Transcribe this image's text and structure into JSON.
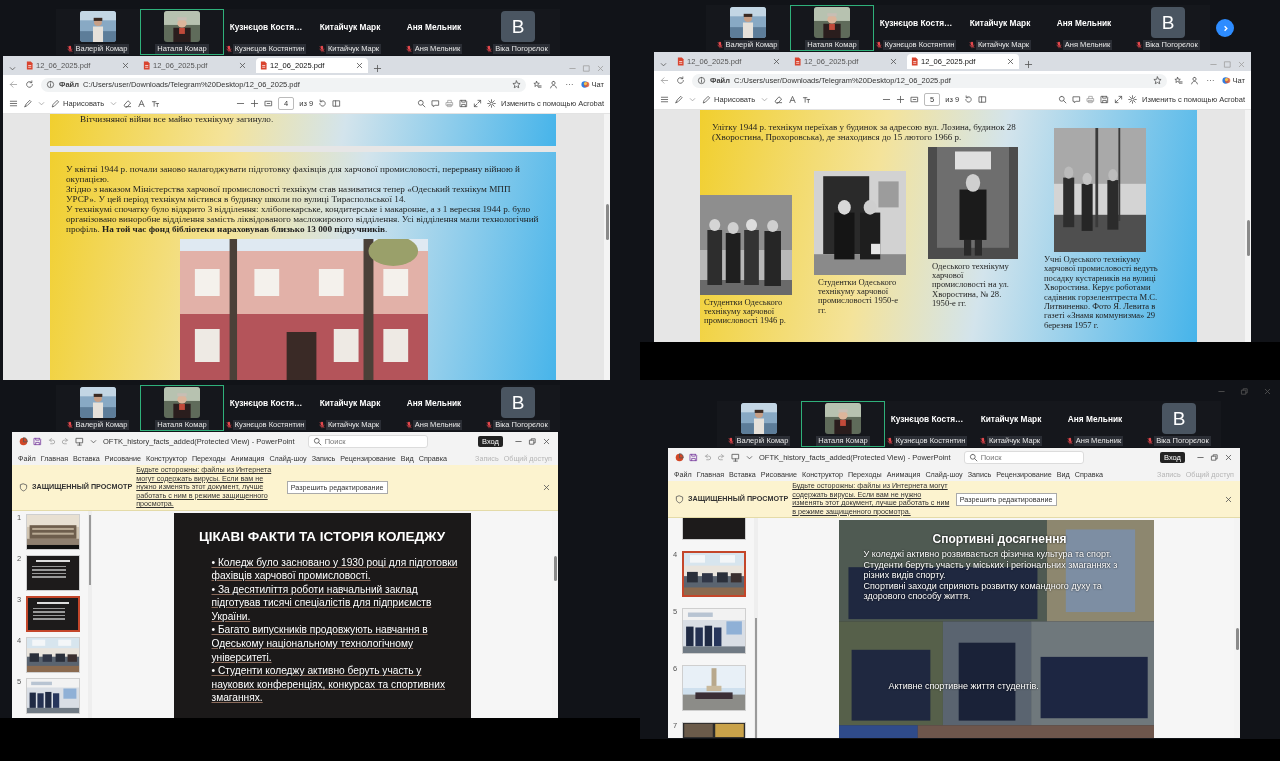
{
  "panes": [
    {
      "kind": "pdf",
      "participants": [
        {
          "kind": "video",
          "label": "Валерій Комар",
          "muted": true,
          "selected": false
        },
        {
          "kind": "video",
          "label": "Наталя Комар",
          "muted": false,
          "selected": true
        },
        {
          "kind": "name",
          "name": "Кузнєцов Костя…",
          "label": "Кузнєцов Костянтин",
          "muted": true,
          "selected": false
        },
        {
          "kind": "name",
          "name": "Китайчук Марк",
          "label": "Китайчук Марк",
          "muted": true,
          "selected": false
        },
        {
          "kind": "name",
          "name": "Аня Мельник",
          "label": "Аня Мельник",
          "muted": true,
          "selected": false
        },
        {
          "kind": "avatar",
          "initial": "B",
          "label": "Віка Погорєлок",
          "muted": true,
          "selected": false
        }
      ],
      "viewer": {
        "tabs": [
          {
            "label": "12_06_2025.pdf",
            "selected": false
          },
          {
            "label": "12_06_2025.pdf",
            "selected": false
          },
          {
            "label": "12_06_2025.pdf",
            "selected": true
          }
        ],
        "file_chip": "Файл",
        "address": "C:/Users/user/Downloads/Telegram%20Desktop/12_06_2025.pdf",
        "chat": "Чат",
        "draw": "Нарисовать",
        "page": "4",
        "page_total": "из 9",
        "edit_action": "Изменить с помощью Acrobat",
        "document": {
          "kind": "article",
          "lead": "Вітчизняної війни все майно технікуму загинуло.",
          "paragraphs": [
            "У квітні 1944 р. почали заново налагоджувати підготовку фахівців для харчової промисловості, перервану війною й окупацією.",
            "Згідно з наказом Міністерства харчової промисловості технікум став називатися тепер «Одеський технікум МПП УРСР». У цей період технікум містився в будинку школи по вулиці Тираспольської 14.",
            "У технікумі спочатку було відкрито 3 відділення: хлібопекарське, кондитерське і макаронне, а з 1 вересня 1944 р. було організовано виноробне відділення замість ліквідованого масложирового відділення. Усі відділення мали технологічний профіль. **На той час фонд бібліотеки нараховував близько 13 000 підручників**."
          ]
        }
      }
    },
    {
      "kind": "pdf",
      "next_button": true,
      "participants": [
        {
          "kind": "video",
          "label": "Валерій Комар",
          "muted": true,
          "selected": false
        },
        {
          "kind": "video",
          "label": "Наталя Комар",
          "muted": false,
          "selected": true
        },
        {
          "kind": "name",
          "name": "Кузнєцов Костя…",
          "label": "Кузнєцов Костянтин",
          "muted": true,
          "selected": false
        },
        {
          "kind": "name",
          "name": "Китайчук Марк",
          "label": "Китайчук Марк",
          "muted": true,
          "selected": false
        },
        {
          "kind": "name",
          "name": "Аня Мельник",
          "label": "Аня Мельник",
          "muted": true,
          "selected": false
        },
        {
          "kind": "avatar",
          "initial": "B",
          "label": "Віка Погорєлок",
          "muted": true,
          "selected": false
        }
      ],
      "viewer": {
        "tabs": [
          {
            "label": "12_06_2025.pdf",
            "selected": false
          },
          {
            "label": "12_06_2025.pdf",
            "selected": false
          },
          {
            "label": "12_06_2025.pdf",
            "selected": true
          }
        ],
        "file_chip": "Файл",
        "address": "C:/Users/user/Downloads/Telegram%20Desktop/12_06_2025.pdf",
        "chat": "Чат",
        "draw": "Нарисовать",
        "page": "5",
        "page_total": "из 9",
        "edit_action": "Изменить с помощью Acrobat",
        "document": {
          "kind": "gallery",
          "paragraphs": [
            "Улітку 1944 р. технікум переїхав у будинок за адресою вул. Лозина, будинок 28 (Хворостина, Прохоровська), де знаходився до 15 лютого 1966 р."
          ],
          "photos": [
            {
              "caption": "Студентки Одеського технікуму харчової промисловості 1946 р."
            },
            {
              "caption": "Студентки Одеського технікуму харчової промисловості 1950-е гг."
            },
            {
              "caption": "Одеського технікуму харчової промисловості на ул. Хворостина, № 28. 1950-е гг."
            },
            {
              "caption": "Учні Одеського технікуму харчової промисловості ведуть посадку кустарників на вулиці Хворостина. Керує роботами садівник горзеленттреста М.С. Литвиненко. Фото Я. Левита в газеті «Знамя коммунизма» 29 березня 1957 г."
            }
          ]
        }
      }
    },
    {
      "kind": "slides",
      "participants": [
        {
          "kind": "video",
          "label": "Валерій Комар",
          "muted": true,
          "selected": false
        },
        {
          "kind": "video",
          "label": "Наталя Комар",
          "muted": false,
          "selected": true
        },
        {
          "kind": "name",
          "name": "Кузнєцов Костя…",
          "label": "Кузнєцов Костянтин",
          "muted": true,
          "selected": false
        },
        {
          "kind": "name",
          "name": "Китайчук Марк",
          "label": "Китайчук Марк",
          "muted": true,
          "selected": false
        },
        {
          "kind": "name",
          "name": "Аня Мельник",
          "label": "Аня Мельник",
          "muted": true,
          "selected": false
        },
        {
          "kind": "avatar",
          "initial": "B",
          "label": "Віка Погорєлок",
          "muted": true,
          "selected": false
        }
      ],
      "app": {
        "title": "OFTK_history_facts_added(Protected View) - PowerPoint",
        "search": {
          "placeholder": "Поиск"
        },
        "signin": "Вход",
        "menu": [
          "Файл",
          "Главная",
          "Вставка",
          "Рисование",
          "Конструктор",
          "Переходы",
          "Анимация",
          "Слайд-шоу",
          "Запись",
          "Рецензирование",
          "Вид",
          "Справка"
        ],
        "actions": [
          {
            "label": "Запись",
            "disabled": true
          },
          {
            "label": "Общий доступ",
            "disabled": true
          }
        ],
        "notice": {
          "label": "ЗАЩИЩЕННЫЙ ПРОСМОТР",
          "message": "Будьте осторожны: файлы из Интернета могут содержать вирусы. Если вам не нужно изменять этот документ, лучше работать с ним в режиме защищенного просмотра.",
          "button": "Разрешить редактирование"
        },
        "thumbnails": [
          {
            "number": "1",
            "selected": false
          },
          {
            "number": "2",
            "kind": "text",
            "selected": false
          },
          {
            "number": "3",
            "kind": "text",
            "selected": true
          },
          {
            "number": "4",
            "selected": false
          },
          {
            "number": "5",
            "selected": false
          }
        ],
        "slide": {
          "kind": "bullets",
          "title": "ЦІКАВІ ФАКТИ ТА ІСТОРІЯ КОЛЕДЖУ",
          "bullets": [
            "• Коледж було засновано у 1930 році для підготовки фахівців харчової промисловості.",
            "• За десятиліття роботи навчальний заклад підготував тисячі спеціалістів для підприємств України.",
            "• Багато випускників продовжують навчання в Одеському національному технологічному університеті.",
            "• Студенти коледжу активно беруть участь у наукових конференціях, конкурсах та спортивних змаганнях."
          ]
        }
      }
    },
    {
      "kind": "slides",
      "window_controls": true,
      "participants": [
        {
          "kind": "video",
          "label": "Валерій Комар",
          "muted": true,
          "selected": false
        },
        {
          "kind": "video",
          "label": "Наталя Комар",
          "muted": false,
          "selected": true
        },
        {
          "kind": "name",
          "name": "Кузнєцов Костя…",
          "label": "Кузнєцов Костянтин",
          "muted": true,
          "selected": false
        },
        {
          "kind": "name",
          "name": "Китайчук Марк",
          "label": "Китайчук Марк",
          "muted": true,
          "selected": false
        },
        {
          "kind": "name",
          "name": "Аня Мельник",
          "label": "Аня Мельник",
          "muted": true,
          "selected": false
        },
        {
          "kind": "avatar",
          "initial": "B",
          "label": "Віка Погорєлок",
          "muted": true,
          "selected": false
        }
      ],
      "app": {
        "title": "OFTK_history_facts_added(Protected View) - PowerPoint",
        "search": {
          "placeholder": "Поиск"
        },
        "signin": "Вход",
        "menu": [
          "Файл",
          "Главная",
          "Вставка",
          "Рисование",
          "Конструктор",
          "Переходы",
          "Анимация",
          "Слайд-шоу",
          "Запись",
          "Рецензирование",
          "Вид",
          "Справка"
        ],
        "actions": [
          {
            "label": "Запись",
            "disabled": true
          },
          {
            "label": "Общий доступ",
            "disabled": true
          }
        ],
        "notice": {
          "label": "ЗАЩИЩЕННЫЙ ПРОСМОТР",
          "message": "Будьте осторожны: файлы из Интернета могут содержать вирусы. Если вам не нужно изменять этот документ, лучше работать с ним в режиме защищенного просмотра.",
          "button": "Разрешить редактирование"
        },
        "thumbnails": [
          {
            "kind": "text",
            "selected": false
          },
          {
            "number": "4",
            "selected": true
          },
          {
            "number": "5",
            "selected": false
          },
          {
            "number": "6",
            "selected": false
          },
          {
            "number": "7",
            "selected": false
          }
        ],
        "slide": {
          "kind": "collage",
          "title": "Спортивні досягнення",
          "lines": [
            "У коледжі активно розвивається фізична культура та спорт.",
            "Студенти беруть участь у міських і регіональних змаганнях з різних видів спорту.",
            "Спортивні заходи сприяють розвитку командного духу та здорового способу життя."
          ],
          "caption": "Активне спортивне життя студентів."
        }
      }
    }
  ]
}
